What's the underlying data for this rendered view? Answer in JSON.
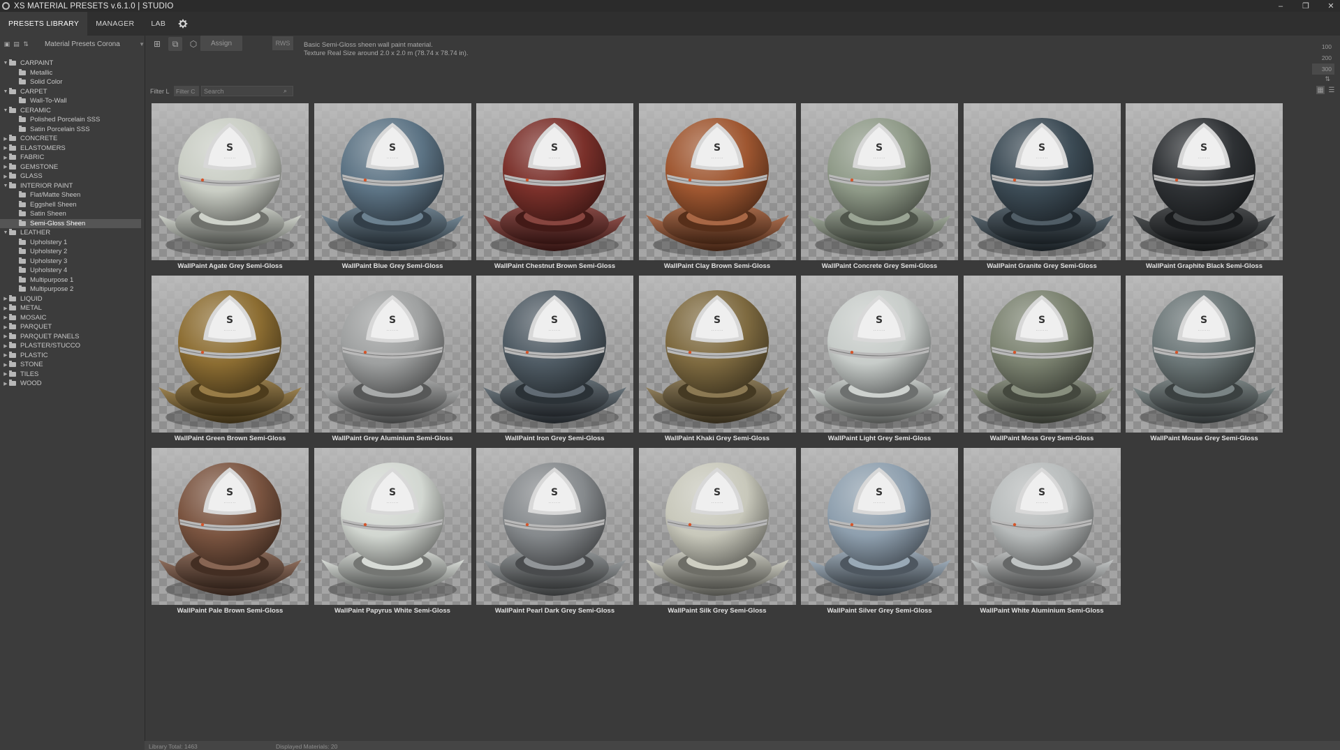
{
  "window": {
    "title": "XS MATERIAL PRESETS v.6.1.0 | STUDIO",
    "controls": [
      "–",
      "❐",
      "✕"
    ]
  },
  "tabs": [
    {
      "label": "PRESETS LIBRARY",
      "active": true
    },
    {
      "label": "MANAGER",
      "active": false
    },
    {
      "label": "LAB",
      "active": false
    }
  ],
  "settings_icon": "gear-icon",
  "sidebar": {
    "library_select": "Material Presets Corona",
    "tree": [
      {
        "label": "CARPAINT",
        "expanded": true,
        "children": [
          "Metallic",
          "Solid Color"
        ]
      },
      {
        "label": "CARPET",
        "expanded": true,
        "children": [
          "Wall-To-Wall"
        ]
      },
      {
        "label": "CERAMIC",
        "expanded": true,
        "children": [
          "Polished Porcelain SSS",
          "Satin Porcelain SSS"
        ]
      },
      {
        "label": "CONCRETE",
        "expanded": false,
        "children": []
      },
      {
        "label": "ELASTOMERS",
        "expanded": false,
        "children": []
      },
      {
        "label": "FABRIC",
        "expanded": false,
        "children": []
      },
      {
        "label": "GEMSTONE",
        "expanded": false,
        "children": []
      },
      {
        "label": "GLASS",
        "expanded": false,
        "children": []
      },
      {
        "label": "INTERIOR PAINT",
        "expanded": true,
        "children": [
          "Flat/Matte Sheen",
          "Eggshell Sheen",
          "Satin Sheen",
          "Semi-Gloss Sheen"
        ]
      },
      {
        "label": "LEATHER",
        "expanded": true,
        "children": [
          "Upholstery 1",
          "Upholstery 2",
          "Upholstery 3",
          "Upholstery 4",
          "Multipurpose 1",
          "Multipurpose 2"
        ]
      },
      {
        "label": "LIQUID",
        "expanded": false,
        "children": []
      },
      {
        "label": "METAL",
        "expanded": false,
        "children": []
      },
      {
        "label": "MOSAIC",
        "expanded": false,
        "children": []
      },
      {
        "label": "PARQUET",
        "expanded": false,
        "children": []
      },
      {
        "label": "PARQUET PANELS",
        "expanded": false,
        "children": []
      },
      {
        "label": "PLASTER/STUCCO",
        "expanded": false,
        "children": []
      },
      {
        "label": "PLASTIC",
        "expanded": false,
        "children": []
      },
      {
        "label": "STONE",
        "expanded": false,
        "children": []
      },
      {
        "label": "TILES",
        "expanded": false,
        "children": []
      },
      {
        "label": "WOOD",
        "expanded": false,
        "children": []
      }
    ],
    "selected": "Semi-Gloss Sheen"
  },
  "toolbar": {
    "assign_label": "Assign",
    "rws_label": "RWS",
    "description_line1": "Basic Semi-Gloss sheen wall paint material.",
    "description_line2": "Texture Real Size around 2.0 x 2.0 m (78.74 x 78.74 in).",
    "thumb_sizes": [
      "100",
      "200",
      "300"
    ],
    "active_size": "300",
    "sort_icon": "sort-icon"
  },
  "filter": {
    "label": "Filter L",
    "dropdown": "Filter C",
    "search_placeholder": "Search"
  },
  "materials": [
    {
      "name": "WallPaint Agate Grey Semi-Gloss",
      "color": "#c9cdc4"
    },
    {
      "name": "WallPaint Blue Grey Semi-Gloss",
      "color": "#5c7384"
    },
    {
      "name": "WallPaint Chestnut Brown Semi-Gloss",
      "color": "#7a302a"
    },
    {
      "name": "WallPaint Clay Brown Semi-Gloss",
      "color": "#9e5630"
    },
    {
      "name": "WallPaint Concrete Grey Semi-Gloss",
      "color": "#8f9a88"
    },
    {
      "name": "WallPaint Granite Grey Semi-Gloss",
      "color": "#3c4b55"
    },
    {
      "name": "WallPaint Graphite Black Semi-Gloss",
      "color": "#2e3134"
    },
    {
      "name": "WallPaint Green Brown Semi-Gloss",
      "color": "#8c6d32"
    },
    {
      "name": "WallPaint Grey Aluminium Semi-Gloss",
      "color": "#9ea0a0"
    },
    {
      "name": "WallPaint Iron Grey Semi-Gloss",
      "color": "#4f5b64"
    },
    {
      "name": "WallPaint Khaki Grey Semi-Gloss",
      "color": "#7e6a40"
    },
    {
      "name": "WallPaint Light Grey Semi-Gloss",
      "color": "#c7ccc9"
    },
    {
      "name": "WallPaint Moss Grey Semi-Gloss",
      "color": "#7b8270"
    },
    {
      "name": "WallPaint Mouse Grey Semi-Gloss",
      "color": "#6b7677"
    },
    {
      "name": "WallPaint Pale Brown Semi-Gloss",
      "color": "#7a5440"
    },
    {
      "name": "WallPaint Papyrus White Semi-Gloss",
      "color": "#d2d7d1"
    },
    {
      "name": "WallPaint Pearl Dark Grey Semi-Gloss",
      "color": "#85898c"
    },
    {
      "name": "WallPaint Silk Grey Semi-Gloss",
      "color": "#c8c8bb"
    },
    {
      "name": "WallPaint Silver Grey Semi-Gloss",
      "color": "#8e9fae"
    },
    {
      "name": "WallPaint White Aluminium Semi-Gloss",
      "color": "#b8bcbc"
    }
  ],
  "status": {
    "library_total": "Library Total: 1463",
    "displayed": "Displayed Materials: 20"
  }
}
